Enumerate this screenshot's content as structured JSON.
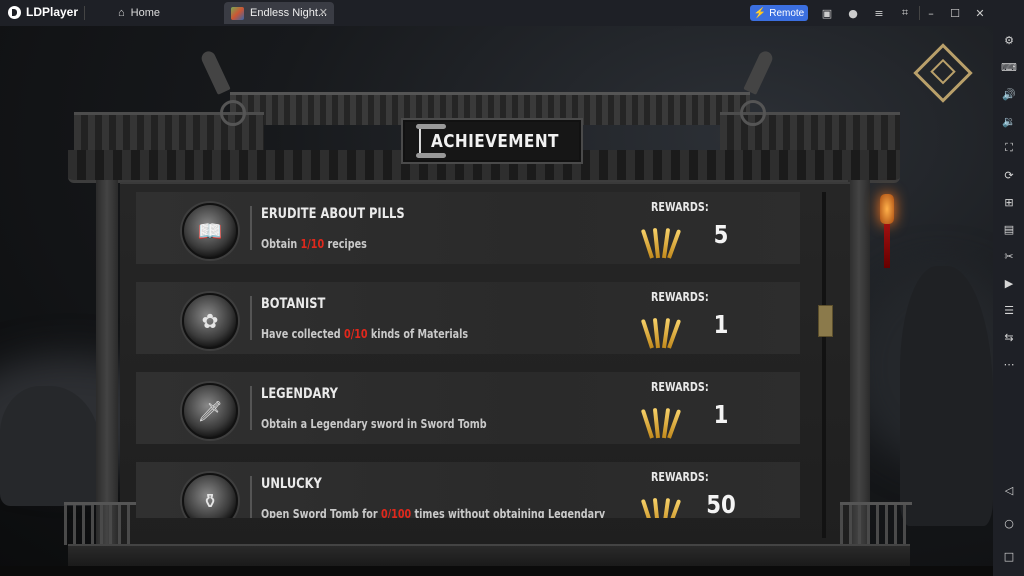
{
  "window": {
    "app_name": "LDPlayer",
    "tabs": [
      {
        "label": "Home"
      },
      {
        "label": "Endless Night..."
      }
    ],
    "tab_close_glyph": "✕",
    "remote_label": "Remote",
    "toolbar_icons": [
      "gamepad-icon",
      "account-icon",
      "menu-icon",
      "screen-crop-icon",
      "minimize-icon",
      "maximize-icon",
      "close-icon"
    ]
  },
  "sidebar": {
    "icons": [
      "settings-icon",
      "keyboard-icon",
      "volume-up-icon",
      "volume-down-icon",
      "fullscreen-icon",
      "sync-icon",
      "add-screen-icon",
      "fps-icon",
      "scissors-icon",
      "video-icon",
      "layers-icon",
      "rotate-icon",
      "more-icon",
      "back-icon",
      "home-circle-icon",
      "square-recent-icon"
    ]
  },
  "game": {
    "title": "ACHIEVEMENT",
    "rewards_label": "REWARDS:",
    "achievements": [
      {
        "name": "ERUDITE ABOUT PILLS",
        "desc_prefix": "Obtain ",
        "desc_progress": "1/10",
        "desc_suffix": " recipes",
        "reward": "5",
        "icon": "book-icon"
      },
      {
        "name": "BOTANIST",
        "desc_prefix": "Have collected ",
        "desc_progress": "0/10",
        "desc_suffix": " kinds of Materials",
        "reward": "1",
        "icon": "flower-icon"
      },
      {
        "name": "LEGENDARY",
        "desc_prefix": "Obtain a Legendary sword in Sword Tomb",
        "desc_progress": "",
        "desc_suffix": "",
        "reward": "1",
        "icon": "sword-icon"
      },
      {
        "name": "UNLUCKY",
        "desc_prefix": "Open Sword Tomb for ",
        "desc_progress": "0/100",
        "desc_suffix": " times without obtaining Legendary",
        "reward": "50",
        "icon": "tomb-icon"
      }
    ],
    "colors": {
      "progress_red": "#e0281c",
      "reward_gold": "#f0c050",
      "remote_blue": "#3b6fe0"
    }
  }
}
